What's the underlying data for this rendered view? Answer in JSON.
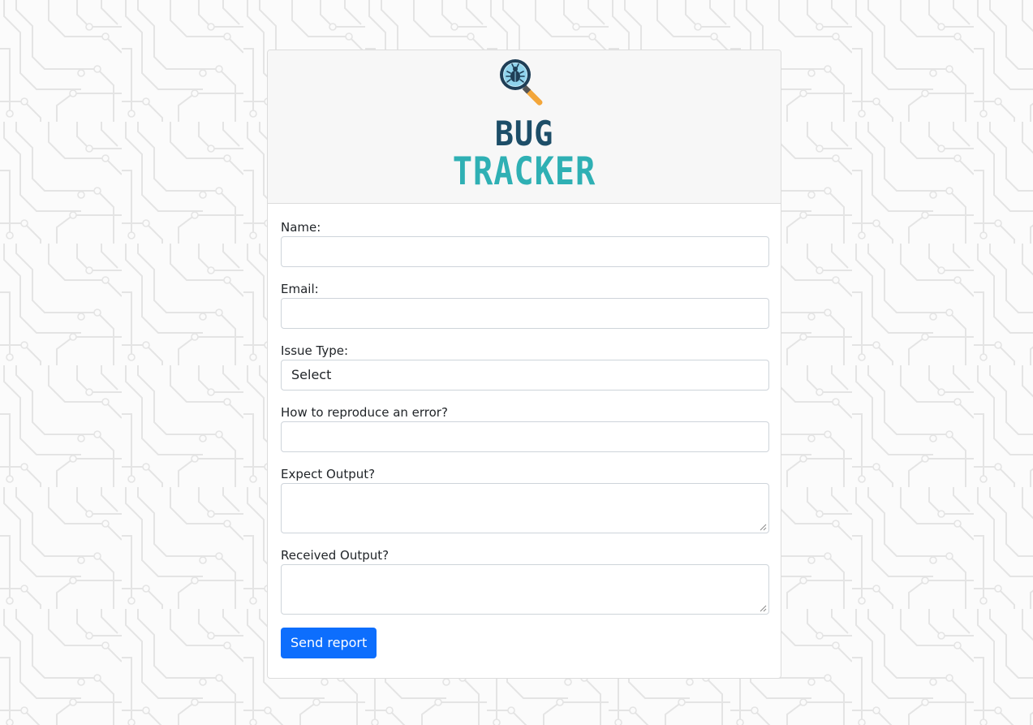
{
  "logo": {
    "line1": "BUG",
    "line2": "TRACKER",
    "icon": "bug-magnifier-icon"
  },
  "form": {
    "name_label": "Name:",
    "email_label": "Email:",
    "issue_type_label": "Issue Type:",
    "issue_type_value": "Select",
    "reproduce_label": "How to reproduce an error?",
    "expected_label": "Expect Output?",
    "received_label": "Received Output?",
    "submit_label": "Send report"
  },
  "colors": {
    "primary": "#0d6efd",
    "logo_dark": "#1d4e68",
    "logo_teal": "#2fb0b4"
  }
}
